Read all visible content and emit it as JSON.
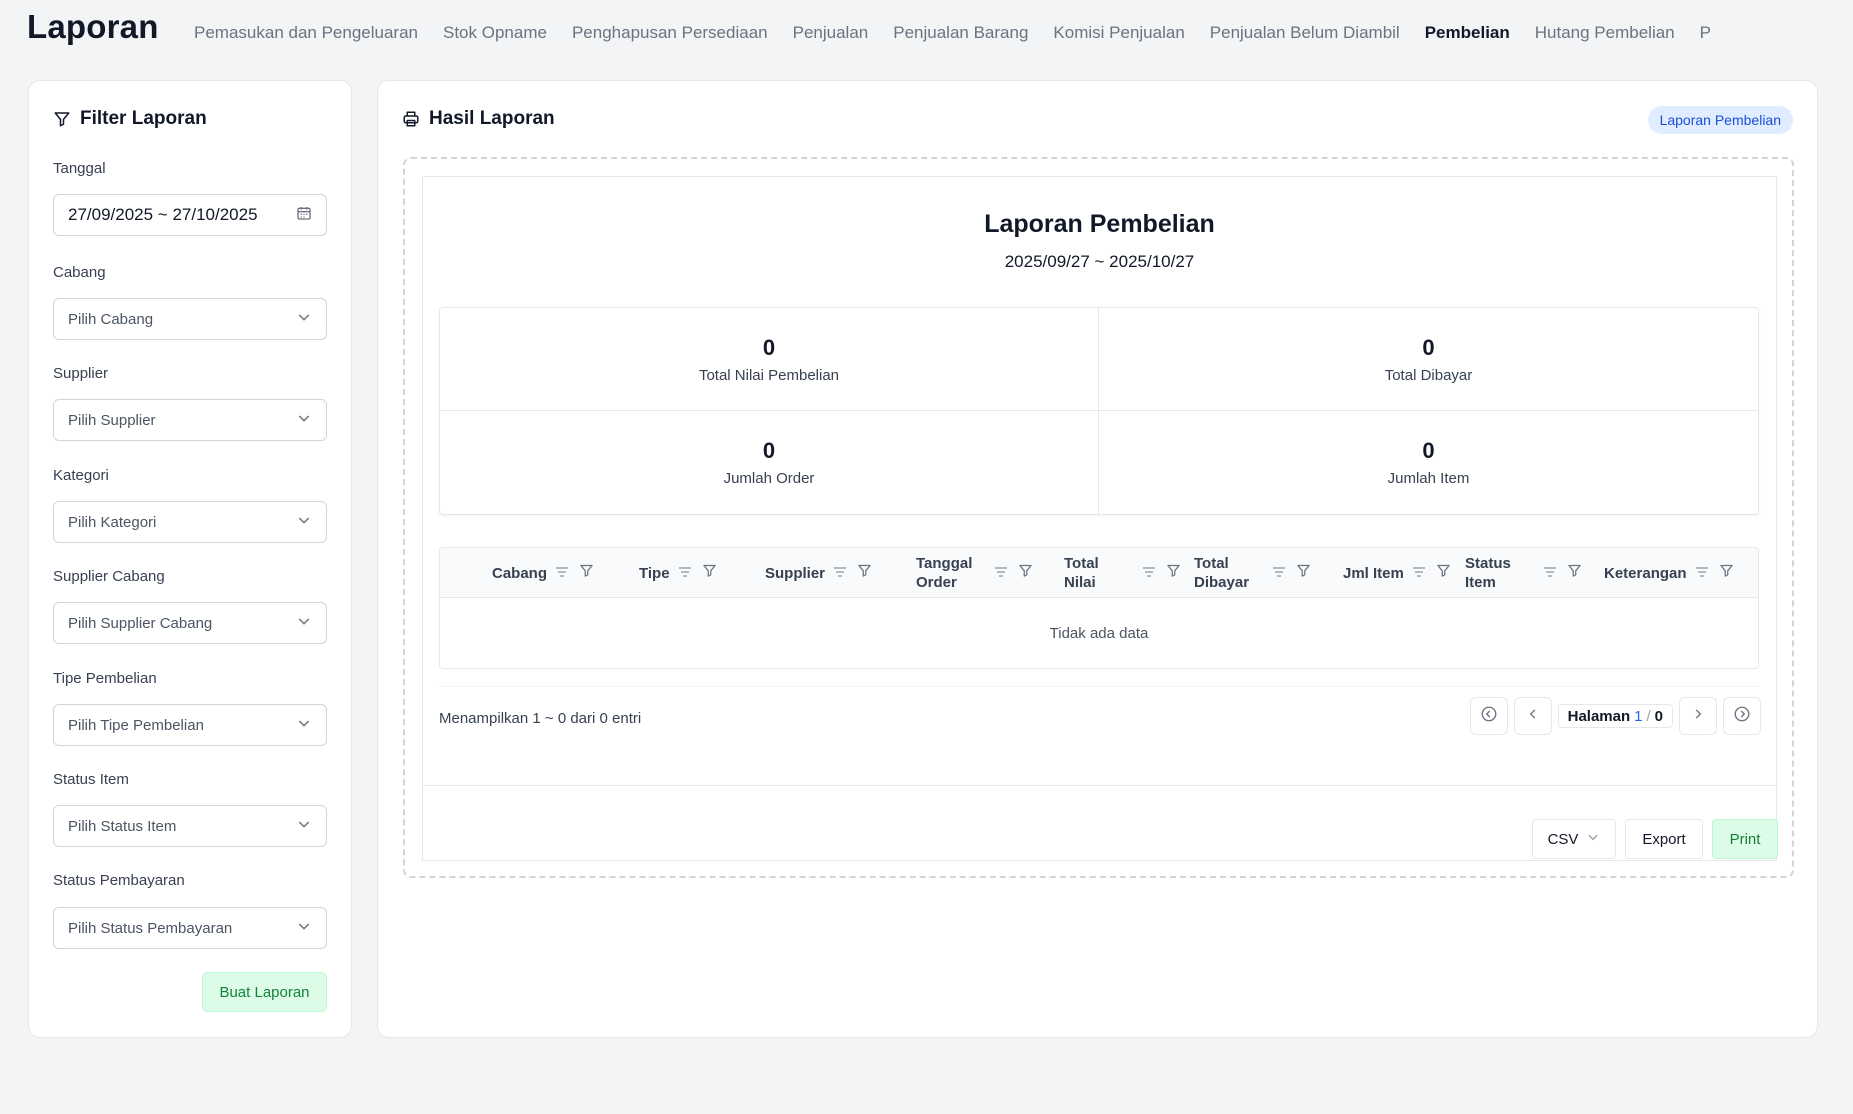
{
  "app": {
    "title": "Laporan"
  },
  "tabs": [
    {
      "label": "Pemasukan dan Pengeluaran",
      "active": false
    },
    {
      "label": "Stok Opname",
      "active": false
    },
    {
      "label": "Penghapusan Persediaan",
      "active": false
    },
    {
      "label": "Penjualan",
      "active": false
    },
    {
      "label": "Penjualan Barang",
      "active": false
    },
    {
      "label": "Komisi Penjualan",
      "active": false
    },
    {
      "label": "Penjualan Belum Diambil",
      "active": false
    },
    {
      "label": "Pembelian",
      "active": true
    },
    {
      "label": "Hutang Pembelian",
      "active": false
    },
    {
      "label": "P",
      "active": false
    }
  ],
  "filter": {
    "title": "Filter Laporan",
    "tanggal_label": "Tanggal",
    "tanggal_value": "27/09/2025 ~ 27/10/2025",
    "cabang_label": "Cabang",
    "cabang_placeholder": "Pilih Cabang",
    "supplier_label": "Supplier",
    "supplier_placeholder": "Pilih Supplier",
    "kategori_label": "Kategori",
    "kategori_placeholder": "Pilih Kategori",
    "supplier_cabang_label": "Supplier Cabang",
    "supplier_cabang_placeholder": "Pilih Supplier Cabang",
    "tipe_label": "Tipe Pembelian",
    "tipe_placeholder": "Pilih Tipe Pembelian",
    "status_item_label": "Status Item",
    "status_item_placeholder": "Pilih Status Item",
    "status_pembayaran_label": "Status Pembayaran",
    "status_pembayaran_placeholder": "Pilih Status Pembayaran",
    "submit_label": "Buat Laporan"
  },
  "result": {
    "title": "Hasil Laporan",
    "badge": "Laporan Pembelian",
    "report_title": "Laporan Pembelian",
    "report_range": "2025/09/27 ~ 2025/10/27",
    "stats": [
      {
        "value": "0",
        "label": "Total Nilai Pembelian"
      },
      {
        "value": "0",
        "label": "Total Dibayar"
      },
      {
        "value": "0",
        "label": "Jumlah Order"
      },
      {
        "value": "0",
        "label": "Jumlah Item"
      }
    ],
    "columns": [
      "Cabang",
      "Tipe",
      "Supplier",
      "Tanggal Order",
      "Total Nilai",
      "Total Dibayar",
      "Jml Item",
      "Status Item",
      "Keterangan"
    ],
    "empty_text": "Tidak ada data",
    "entries_text": "Menampilkan 1 ~ 0 dari 0 entri",
    "pagination": {
      "label": "Halaman",
      "current": "1",
      "separator": "/",
      "total": "0"
    },
    "format_value": "CSV",
    "export_label": "Export",
    "print_label": "Print"
  },
  "colors": {
    "accent_green": "#15803d",
    "accent_green_bg": "#dcfce7",
    "badge_blue": "#1d4ed8",
    "badge_blue_bg": "#e0ecff"
  },
  "icons": {
    "filter_title": "filter-icon",
    "result_title": "printer-icon",
    "date": "calendar-icon",
    "select": "chevron-down-icon",
    "column_sort": "sort-lines-icon",
    "column_filter": "filter-icon",
    "pager_first": "circle-chevrons-left-icon",
    "pager_prev": "chevron-left-icon",
    "pager_next": "chevron-right-icon",
    "pager_last": "circle-chevrons-right-icon"
  }
}
